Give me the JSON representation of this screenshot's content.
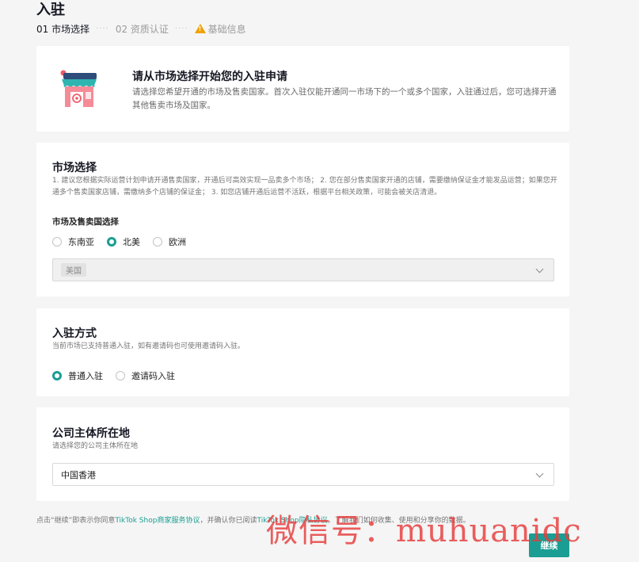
{
  "page": {
    "title": "入驻"
  },
  "steps": [
    {
      "label": "01 市场选择",
      "state": "active"
    },
    {
      "label": "02 资质认证",
      "state": "inactive"
    },
    {
      "label": "基础信息",
      "state": "warning"
    }
  ],
  "step_separator": "····",
  "intro": {
    "title": "请从市场选择开始您的入驻申请",
    "description": "请选择您希望开通的市场及售卖国家。首次入驻仅能开通同一市场下的一个或多个国家，入驻通过后，您可选择开通其他售卖市场及国家。"
  },
  "market": {
    "title": "市场选择",
    "description": "1. 建议您根据实际运营计划申请开通售卖国家，开通后可高效实现一品卖多个市场； 2. 您在部分售卖国家开通的店铺，需要缴纳保证金才能发品运营；如果您开通多个售卖国家店铺，需缴纳多个店铺的保证金； 3. 如您店铺开通后运营不活跃，根据平台相关政策，可能会被关店清退。",
    "subtitle": "市场及售卖国选择",
    "options": [
      {
        "label": "东南亚",
        "checked": false
      },
      {
        "label": "北美",
        "checked": true
      },
      {
        "label": "欧洲",
        "checked": false
      }
    ],
    "country_tag": "美国"
  },
  "method": {
    "title": "入驻方式",
    "description": "当前市场已支持普通入驻，如有邀请码也可使用邀请码入驻。",
    "options": [
      {
        "label": "普通入驻",
        "checked": true
      },
      {
        "label": "邀请码入驻",
        "checked": false
      }
    ]
  },
  "company": {
    "title": "公司主体所在地",
    "description": "请选择您的公司主体所在地",
    "selected": "中国香港"
  },
  "footer": {
    "prefix": "点击“继续”即表示你同意",
    "link1": "TikTok Shop商家服务协议",
    "middle": "，并确认你已阅读",
    "link2": "TikTok Shop隐私协议",
    "suffix": "，了解我们如何收集、使用和分享你的数据。"
  },
  "continue_label": "继续",
  "watermark": "微信号：muhuanidc",
  "colors": {
    "accent": "#1a9e94",
    "warning": "#f0a100",
    "watermark": "#e63c3c"
  }
}
